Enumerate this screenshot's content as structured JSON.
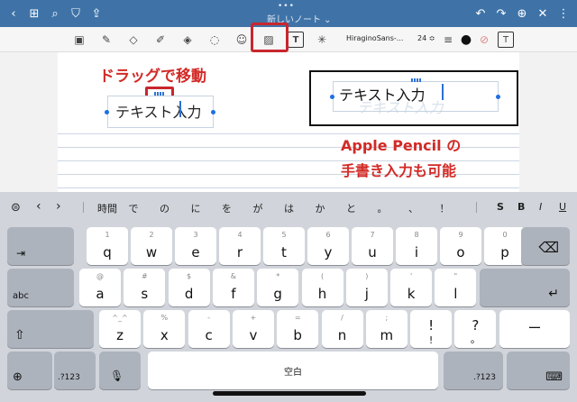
{
  "header": {
    "title": "新しいノート ⌄",
    "dots": "•••",
    "icons": {
      "back": "‹",
      "grid": "⊞",
      "search": "⌕",
      "bookmark": "⛉",
      "share": "⇪",
      "undo": "↶",
      "redo": "↷",
      "add_page": "⊕",
      "close": "✕",
      "more": "⋮"
    }
  },
  "toolbar": {
    "font_name": "HiraginoSans-...",
    "font_size": "24 ≎",
    "tools": {
      "lasso_scan": "▣",
      "pen": "✎",
      "eraser": "◇",
      "highlighter": "✐",
      "shapes": "◈",
      "lasso": "◌",
      "sticker": "☺",
      "image": "▨",
      "text": "T",
      "laser": "✳",
      "align": "≡",
      "color": "●",
      "slash": "⊘",
      "text_style": "T"
    }
  },
  "annotations": {
    "drag_label": "ドラッグで移動",
    "pencil_line1": "Apple Pencil の",
    "pencil_line2": "手書き入力も可能"
  },
  "note": {
    "textbox1": "テキスト入力",
    "textbox2": "テキスト入力",
    "textbox2_ghost": "テキスト入力"
  },
  "keyboard": {
    "predict_left": {
      "format": "⊜",
      "prev": "‹",
      "next": "›"
    },
    "predictions": [
      "時間",
      "で",
      "の",
      "に",
      "を",
      "が",
      "は",
      "か",
      "と",
      "。",
      "、",
      "！"
    ],
    "predict_right": {
      "bold": "S",
      "bold2": "B",
      "italic": "I",
      "underline": "U"
    },
    "row1": [
      {
        "main": "q",
        "sub": "1"
      },
      {
        "main": "w",
        "sub": "2"
      },
      {
        "main": "e",
        "sub": "3"
      },
      {
        "main": "r",
        "sub": "4"
      },
      {
        "main": "t",
        "sub": "5"
      },
      {
        "main": "y",
        "sub": "6"
      },
      {
        "main": "u",
        "sub": "7"
      },
      {
        "main": "i",
        "sub": "8"
      },
      {
        "main": "o",
        "sub": "9"
      },
      {
        "main": "p",
        "sub": "0"
      }
    ],
    "row2": [
      {
        "main": "a",
        "sub": "@"
      },
      {
        "main": "s",
        "sub": "#"
      },
      {
        "main": "d",
        "sub": "$"
      },
      {
        "main": "f",
        "sub": "&"
      },
      {
        "main": "g",
        "sub": "*"
      },
      {
        "main": "h",
        "sub": "("
      },
      {
        "main": "j",
        "sub": ")"
      },
      {
        "main": "k",
        "sub": "'"
      },
      {
        "main": "l",
        "sub": "\""
      }
    ],
    "row3": [
      {
        "main": "z",
        "sub": "^_^"
      },
      {
        "main": "x",
        "sub": "%"
      },
      {
        "main": "c",
        "sub": "-"
      },
      {
        "main": "v",
        "sub": "+"
      },
      {
        "main": "b",
        "sub": "="
      },
      {
        "main": "n",
        "sub": "/"
      },
      {
        "main": "m",
        "sub": ";"
      },
      {
        "main": "!",
        "sub": ""
      },
      {
        "main": "?",
        "sub": ""
      }
    ],
    "row3_marks": {
      "excl_under": "!",
      "q_under": "。",
      "dash": "ー"
    },
    "tab_label": "⇥",
    "abc_label": "abc",
    "shift_label": "⇧",
    "delete_label": "⌫",
    "return_label": "↵",
    "globe_label": "⊕",
    "num_label_left": ".?123",
    "mic_label": "🎙",
    "space_label": "空白",
    "num_label_right": ".?123",
    "hide_label": "⌨"
  }
}
